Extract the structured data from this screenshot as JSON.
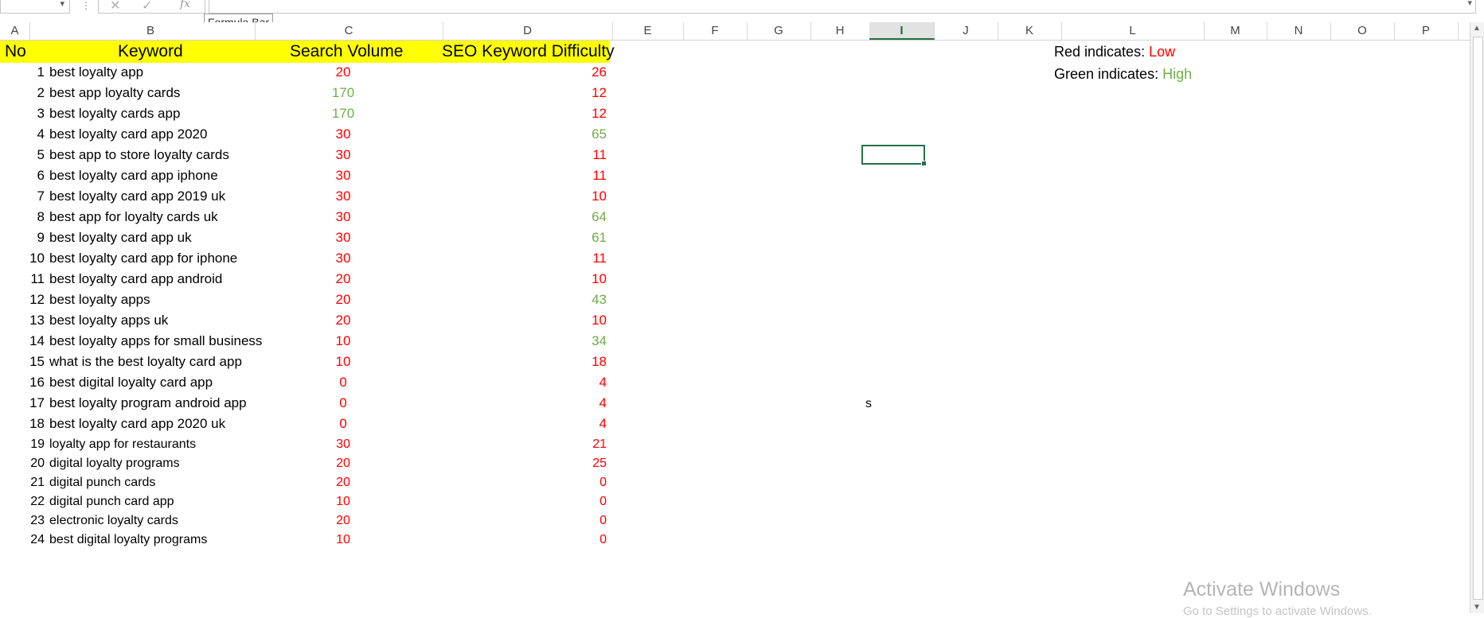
{
  "formula_bar": {
    "tooltip": "Formula Bar",
    "cancel_icon": "✕",
    "enter_icon": "✓",
    "fx_label": "fx"
  },
  "columns": [
    "A",
    "B",
    "C",
    "D",
    "E",
    "F",
    "G",
    "H",
    "I",
    "J",
    "K",
    "L",
    "M",
    "N",
    "O",
    "P"
  ],
  "selected_column": "I",
  "table": {
    "headers": {
      "no": "No",
      "keyword": "Keyword",
      "search_volume": "Search Volume",
      "difficulty": "SEO Keyword Difficulty"
    },
    "rows": [
      {
        "no": "1",
        "keyword": "best loyalty app",
        "sv": "20",
        "sv_color": "#ff0000",
        "kd": "26",
        "kd_color": "#ff0000"
      },
      {
        "no": "2",
        "keyword": "best app loyalty cards",
        "sv": "170",
        "sv_color": "#70ad47",
        "kd": "12",
        "kd_color": "#ff0000"
      },
      {
        "no": "3",
        "keyword": "best loyalty cards app",
        "sv": "170",
        "sv_color": "#70ad47",
        "kd": "12",
        "kd_color": "#ff0000"
      },
      {
        "no": "4",
        "keyword": "best loyalty card app 2020",
        "sv": "30",
        "sv_color": "#ff0000",
        "kd": "65",
        "kd_color": "#70ad47"
      },
      {
        "no": "5",
        "keyword": "best app to store loyalty cards",
        "sv": "30",
        "sv_color": "#ff0000",
        "kd": "11",
        "kd_color": "#ff0000"
      },
      {
        "no": "6",
        "keyword": "best loyalty card app iphone",
        "sv": "30",
        "sv_color": "#ff0000",
        "kd": "11",
        "kd_color": "#ff0000"
      },
      {
        "no": "7",
        "keyword": "best loyalty card app 2019 uk",
        "sv": "30",
        "sv_color": "#ff0000",
        "kd": "10",
        "kd_color": "#ff0000"
      },
      {
        "no": "8",
        "keyword": "best app for loyalty cards uk",
        "sv": "30",
        "sv_color": "#ff0000",
        "kd": "64",
        "kd_color": "#70ad47"
      },
      {
        "no": "9",
        "keyword": "best loyalty card app uk",
        "sv": "30",
        "sv_color": "#ff0000",
        "kd": "61",
        "kd_color": "#70ad47"
      },
      {
        "no": "10",
        "keyword": "best loyalty card app for iphone",
        "sv": "30",
        "sv_color": "#ff0000",
        "kd": "11",
        "kd_color": "#ff0000"
      },
      {
        "no": "11",
        "keyword": "best loyalty card app android",
        "sv": "20",
        "sv_color": "#ff0000",
        "kd": "10",
        "kd_color": "#ff0000"
      },
      {
        "no": "12",
        "keyword": "best loyalty apps",
        "sv": "20",
        "sv_color": "#ff0000",
        "kd": "43",
        "kd_color": "#70ad47"
      },
      {
        "no": "13",
        "keyword": "best loyalty apps uk",
        "sv": "20",
        "sv_color": "#ff0000",
        "kd": "10",
        "kd_color": "#ff0000"
      },
      {
        "no": "14",
        "keyword": "best loyalty apps for small business",
        "sv": "10",
        "sv_color": "#ff0000",
        "kd": "34",
        "kd_color": "#70ad47"
      },
      {
        "no": "15",
        "keyword": "what is the best loyalty card app",
        "sv": "10",
        "sv_color": "#ff0000",
        "kd": "18",
        "kd_color": "#ff0000"
      },
      {
        "no": "16",
        "keyword": "best digital loyalty card app",
        "sv": "0",
        "sv_color": "#ff0000",
        "kd": "4",
        "kd_color": "#ff0000"
      },
      {
        "no": "17",
        "keyword": "best loyalty program android app",
        "sv": "0",
        "sv_color": "#ff0000",
        "kd": "4",
        "kd_color": "#ff0000"
      },
      {
        "no": "18",
        "keyword": "best loyalty card app 2020 uk",
        "sv": "0",
        "sv_color": "#ff0000",
        "kd": "4",
        "kd_color": "#ff0000"
      },
      {
        "no": "19",
        "keyword": "loyalty app for restaurants",
        "sv": "30",
        "sv_color": "#ff0000",
        "kd": "21",
        "kd_color": "#ff0000"
      },
      {
        "no": "20",
        "keyword": "digital loyalty programs",
        "sv": "20",
        "sv_color": "#ff0000",
        "kd": "25",
        "kd_color": "#ff0000"
      },
      {
        "no": "21",
        "keyword": "digital punch cards",
        "sv": "20",
        "sv_color": "#ff0000",
        "kd": "0",
        "kd_color": "#ff0000"
      },
      {
        "no": "22",
        "keyword": "digital punch card app",
        "sv": "10",
        "sv_color": "#ff0000",
        "kd": "0",
        "kd_color": "#ff0000"
      },
      {
        "no": "23",
        "keyword": "electronic loyalty cards",
        "sv": "20",
        "sv_color": "#ff0000",
        "kd": "0",
        "kd_color": "#ff0000"
      },
      {
        "no": "24",
        "keyword": "best digital loyalty programs",
        "sv": "10",
        "sv_color": "#ff0000",
        "kd": "0",
        "kd_color": "#ff0000"
      }
    ]
  },
  "legend": {
    "red_prefix": "Red indicates: ",
    "red_value": "Low",
    "green_prefix": "Green indicates: ",
    "green_value": "High"
  },
  "stray_cell_text": "s",
  "watermark": {
    "line1": "Activate Windows",
    "line2": "Go to Settings to activate Windows."
  },
  "colors": {
    "low": "#ff0000",
    "high": "#70ad47",
    "header_fill": "#ffff00",
    "excel_green": "#217346"
  }
}
